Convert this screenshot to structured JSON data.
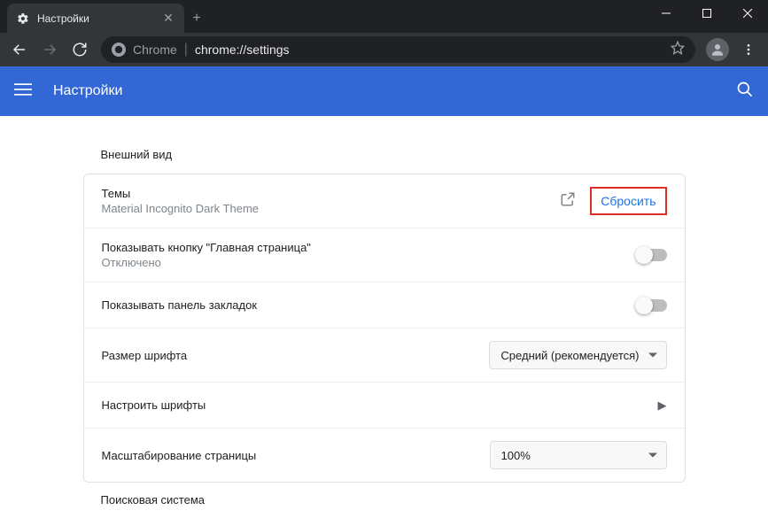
{
  "window": {
    "tab_title": "Настройки",
    "omnibox_prefix": "Chrome",
    "omnibox_url": "chrome://settings"
  },
  "appbar": {
    "title": "Настройки"
  },
  "sections": {
    "appearance": {
      "title": "Внешний вид",
      "theme_row": {
        "title": "Темы",
        "subtitle": "Material Incognito Dark Theme",
        "reset_label": "Сбросить"
      },
      "home_button_row": {
        "title": "Показывать кнопку \"Главная страница\"",
        "subtitle": "Отключено"
      },
      "bookmarks_bar_row": {
        "title": "Показывать панель закладок"
      },
      "font_size_row": {
        "title": "Размер шрифта",
        "value": "Средний (рекомендуется)"
      },
      "customize_fonts_row": {
        "title": "Настроить шрифты"
      },
      "page_zoom_row": {
        "title": "Масштабирование страницы",
        "value": "100%"
      }
    },
    "search_engine": {
      "title": "Поисковая система"
    }
  }
}
